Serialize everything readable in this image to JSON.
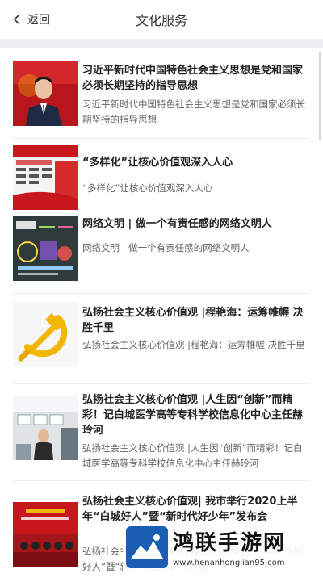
{
  "header": {
    "back_label": "返回",
    "title": "文化服务"
  },
  "articles": [
    {
      "title": "习近平新时代中国特色社会主义思想是党和国家必须长期坚持的指导思想",
      "summary": "习近平新时代中国特色社会主义思想是党和国家必须长期坚持的指导思想",
      "thumb_icon": "portrait-photo-icon"
    },
    {
      "title": "“多样化”让核心价值观深入人心",
      "summary": "“多样化”让核心价值观深入人心",
      "thumb_icon": "poster-board-icon"
    },
    {
      "title": "网络文明 | 做一个有责任感的网络文明人",
      "summary": "网络文明 | 做一个有责任感的网络文明人",
      "thumb_icon": "blackboard-drawing-icon"
    },
    {
      "title": "弘扬社会主义核心价值观 |程艳海：运筹帷幄 决胜千里",
      "summary": "弘扬社会主义核心价值观 |程艳海：运筹帷幄 决胜千里",
      "thumb_icon": "hammer-sickle-icon"
    },
    {
      "title": "弘扬社会主义核心价值观 |人生因“创新”而精彩！记白城医学高等专科学校信息化中心主任赫玲河",
      "summary": "弘扬社会主义核心价值观 |人生因“创新”而精彩！记白城医学高等专科学校信息化中心主任赫玲河",
      "thumb_icon": "classroom-photo-icon"
    },
    {
      "title": "弘扬社会主义核心价值观| 我市举行2020上半年“白城好人”暨“新时代好少年”发布会",
      "summary": "弘扬社会主义核心价值观| 我市举行2020上半年“白城好人”暨“新时代好少年”发布会",
      "thumb_icon": "stage-event-icon"
    }
  ],
  "watermark": {
    "name": "鸿联手游网",
    "url": "www.henanhonglian95.com"
  },
  "colors": {
    "divider": "#f0f0f2",
    "title_text": "#222222",
    "summary_text": "#666666",
    "red_accent": "#c8161d",
    "gold_accent": "#f2b705",
    "watermark_blue": "#1a5fb4"
  }
}
